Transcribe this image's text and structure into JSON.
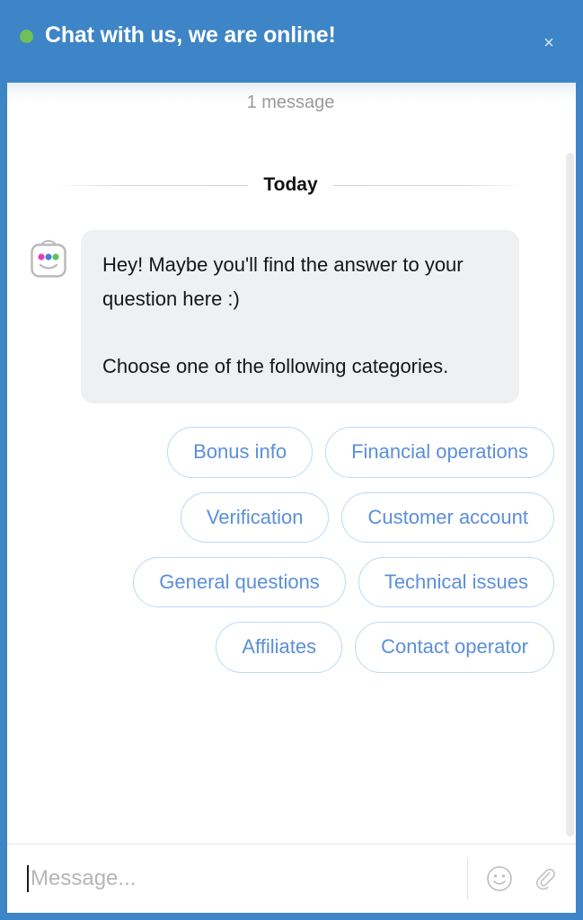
{
  "header": {
    "title": "Chat with us, we are online!",
    "status_icon": "online-status-dot",
    "status_color": "#6ec057",
    "background_color": "#3d85c6",
    "close_label": "×"
  },
  "conversation": {
    "message_count": "1 message",
    "day_separator": "Today",
    "avatar_icon": "robot-avatar-icon",
    "avatar_dot_colors": [
      "#e040c0",
      "#4a7fd4",
      "#5cc45c"
    ],
    "message": {
      "paragraphs": [
        "Hey! Maybe you'll find the answer to your question here :)",
        "Choose one of the following categories."
      ],
      "bubble_color": "#eff0f2"
    }
  },
  "quick_replies": {
    "accent_color": "#5b8fd9",
    "border_color": "#bfd8f2",
    "items": [
      {
        "label": "Bonus info"
      },
      {
        "label": "Financial operations"
      },
      {
        "label": "Verification"
      },
      {
        "label": "Customer account"
      },
      {
        "label": "General questions"
      },
      {
        "label": "Technical issues"
      },
      {
        "label": "Affiliates"
      },
      {
        "label": "Contact operator"
      }
    ]
  },
  "composer": {
    "placeholder": "Message...",
    "value": "",
    "emoji_icon": "smiley-face-icon",
    "attach_icon": "paperclip-icon"
  }
}
